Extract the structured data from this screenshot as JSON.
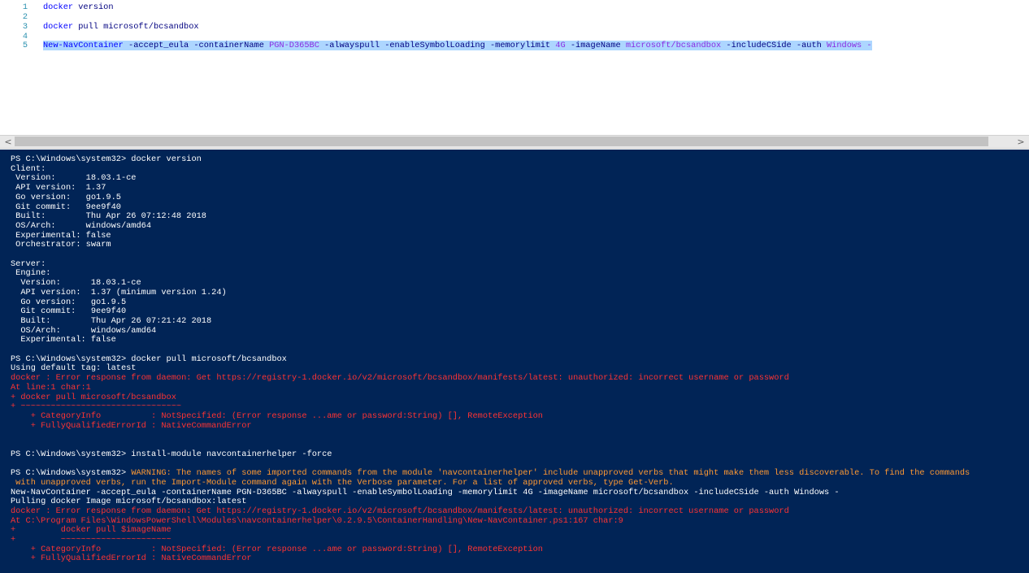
{
  "editor": {
    "lines": [
      {
        "num": "1",
        "tokens": [
          {
            "t": "docker",
            "c": "cmd"
          },
          {
            "t": " version",
            "c": "par"
          }
        ]
      },
      {
        "num": "2",
        "tokens": []
      },
      {
        "num": "3",
        "tokens": [
          {
            "t": "docker",
            "c": "cmd"
          },
          {
            "t": " pull microsoft/bcsandbox",
            "c": "par"
          }
        ]
      },
      {
        "num": "4",
        "tokens": []
      },
      {
        "num": "5",
        "selected": true,
        "tokens": [
          {
            "t": "New-NavContainer",
            "c": "cmd"
          },
          {
            "t": " -accept_eula -containerName ",
            "c": "par"
          },
          {
            "t": "PGN-D365BC",
            "c": "str"
          },
          {
            "t": " -alwayspull -enableSymbolLoading -memorylimit ",
            "c": "par"
          },
          {
            "t": "4G",
            "c": "str"
          },
          {
            "t": " -imageName ",
            "c": "par"
          },
          {
            "t": "microsoft/bcsandbox",
            "c": "str"
          },
          {
            "t": " -includeCSide -auth ",
            "c": "par"
          },
          {
            "t": "Windows -",
            "c": "str"
          }
        ]
      }
    ]
  },
  "scrollbar": {
    "left_arrow": "<",
    "right_arrow": ">"
  },
  "console": {
    "lines": [
      {
        "t": "PS C:\\Windows\\system32> docker version"
      },
      {
        "t": "Client:"
      },
      {
        "t": " Version:      18.03.1-ce"
      },
      {
        "t": " API version:  1.37"
      },
      {
        "t": " Go version:   go1.9.5"
      },
      {
        "t": " Git commit:   9ee9f40"
      },
      {
        "t": " Built:        Thu Apr 26 07:12:48 2018"
      },
      {
        "t": " OS/Arch:      windows/amd64"
      },
      {
        "t": " Experimental: false"
      },
      {
        "t": " Orchestrator: swarm"
      },
      {
        "t": ""
      },
      {
        "t": "Server:"
      },
      {
        "t": " Engine:"
      },
      {
        "t": "  Version:      18.03.1-ce"
      },
      {
        "t": "  API version:  1.37 (minimum version 1.24)"
      },
      {
        "t": "  Go version:   go1.9.5"
      },
      {
        "t": "  Git commit:   9ee9f40"
      },
      {
        "t": "  Built:        Thu Apr 26 07:21:42 2018"
      },
      {
        "t": "  OS/Arch:      windows/amd64"
      },
      {
        "t": "  Experimental: false"
      },
      {
        "t": ""
      },
      {
        "t": "PS C:\\Windows\\system32> docker pull microsoft/bcsandbox"
      },
      {
        "t": "Using default tag: latest"
      },
      {
        "t": "docker : Error response from daemon: Get https://registry-1.docker.io/v2/microsoft/bcsandbox/manifests/latest: unauthorized: incorrect username or password",
        "c": "red"
      },
      {
        "t": "At line:1 char:1",
        "c": "red"
      },
      {
        "t": "+ docker pull microsoft/bcsandbox",
        "c": "red"
      },
      {
        "t": "+ ~~~~~~~~~~~~~~~~~~~~~~~~~~~~~~~~",
        "c": "red"
      },
      {
        "t": "    + CategoryInfo          : NotSpecified: (Error response ...ame or password:String) [], RemoteException",
        "c": "red"
      },
      {
        "t": "    + FullyQualifiedErrorId : NativeCommandError",
        "c": "red"
      },
      {
        "t": ""
      },
      {
        "t": ""
      },
      {
        "t": "PS C:\\Windows\\system32> install-module navcontainerhelper -force"
      },
      {
        "t": ""
      },
      {
        "parts": [
          {
            "t": "PS C:\\Windows\\system32> "
          },
          {
            "t": "WARNING: The names of some imported commands from the module 'navcontainerhelper' include unapproved verbs that might make them less discoverable. To find the commands",
            "c": "warn"
          }
        ]
      },
      {
        "t": " with unapproved verbs, run the Import-Module command again with the Verbose parameter. For a list of approved verbs, type Get-Verb.",
        "c": "warn"
      },
      {
        "t": "New-NavContainer -accept_eula -containerName PGN-D365BC -alwayspull -enableSymbolLoading -memorylimit 4G -imageName microsoft/bcsandbox -includeCSide -auth Windows -"
      },
      {
        "t": "Pulling docker Image microsoft/bcsandbox:latest"
      },
      {
        "t": "docker : Error response from daemon: Get https://registry-1.docker.io/v2/microsoft/bcsandbox/manifests/latest: unauthorized: incorrect username or password",
        "c": "red"
      },
      {
        "t": "At C:\\Program Files\\WindowsPowerShell\\Modules\\navcontainerhelper\\0.2.9.5\\ContainerHandling\\New-NavContainer.ps1:167 char:9",
        "c": "red"
      },
      {
        "t": "+         docker pull $imageName",
        "c": "red"
      },
      {
        "t": "+         ~~~~~~~~~~~~~~~~~~~~~~",
        "c": "red"
      },
      {
        "t": "    + CategoryInfo          : NotSpecified: (Error response ...ame or password:String) [], RemoteException",
        "c": "red"
      },
      {
        "t": "    + FullyQualifiedErrorId : NativeCommandError",
        "c": "red"
      }
    ]
  },
  "colors": {
    "console_bg": "#012456",
    "console_fg": "#ffffff",
    "error": "#ff3333",
    "warning": "#ff9933",
    "selection": "#add6ff",
    "line_numbers": "#2b91af"
  }
}
